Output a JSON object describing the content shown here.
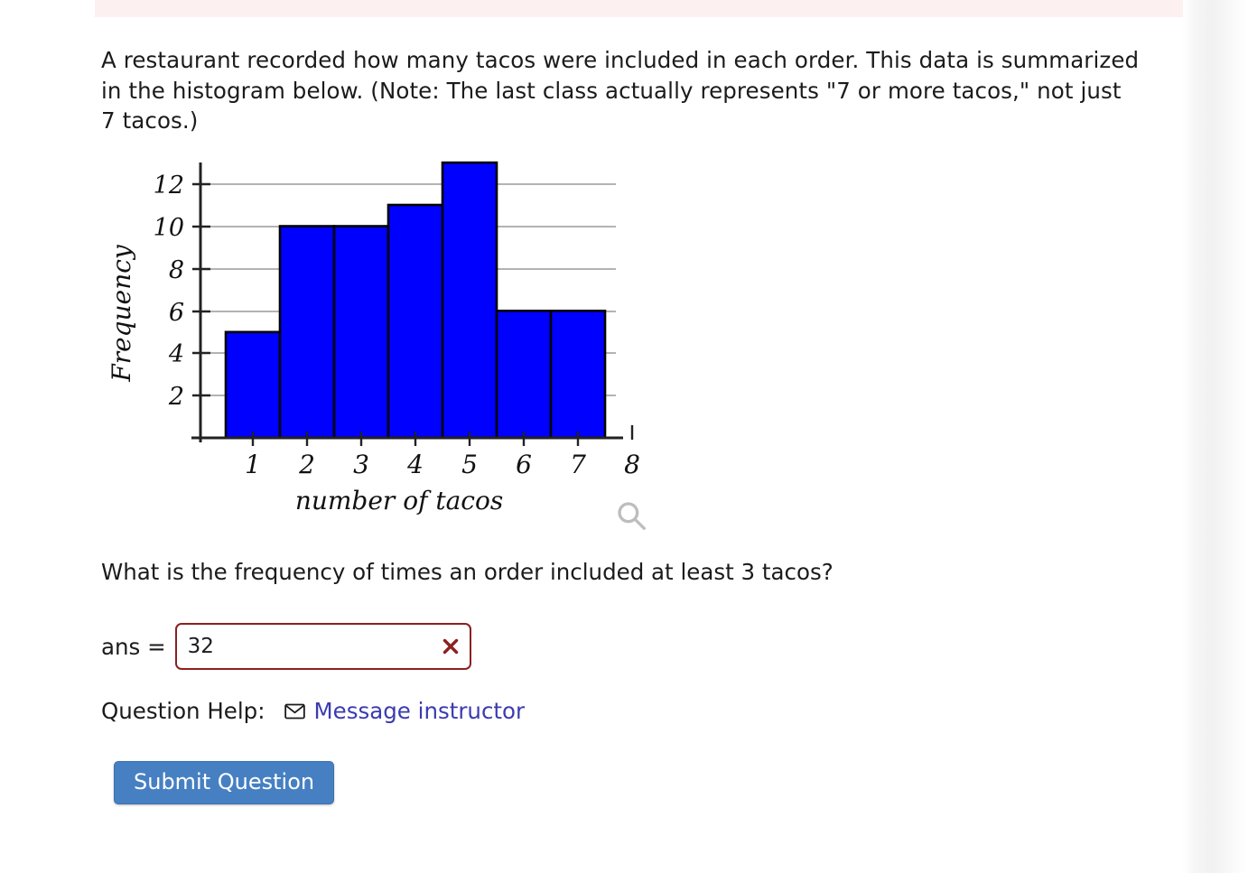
{
  "banner": {
    "color": "#fcf0f0"
  },
  "prompt": {
    "text": "A restaurant recorded how many tacos were included in each order. This data is summarized in the histogram below. (Note: The last class actually represents \"7 or more tacos,\" not just 7 tacos.)"
  },
  "subquestion": {
    "text": "What is the frequency of times an order included at least 3 tacos?"
  },
  "answer": {
    "label": "ans =",
    "value": "32",
    "placeholder": "",
    "status_icon": "x-mark-icon",
    "status_color": "#8c2020",
    "border_color": "#8c2020"
  },
  "help": {
    "label": "Question Help:",
    "icon": "envelope-icon",
    "link_label": "Message instructor",
    "link_color": "#3b3bb0"
  },
  "submit": {
    "label": "Submit Question",
    "color": "#4680c2"
  },
  "figure": {
    "zoom_icon": "magnifier-icon",
    "bar_color": "#0000ff",
    "outline_color": "#000000",
    "gridline_color": "#9a9a9a"
  },
  "chart_data": {
    "type": "bar",
    "title": "",
    "xlabel": "number of tacos",
    "ylabel": "Frequency",
    "categories": [
      "1",
      "2",
      "3",
      "4",
      "5",
      "6",
      "7"
    ],
    "values": [
      5,
      10,
      10,
      11,
      13,
      6,
      6
    ],
    "x_tick_labels": [
      "1",
      "2",
      "3",
      "4",
      "5",
      "6",
      "7",
      "8"
    ],
    "y_tick_labels": [
      "2",
      "4",
      "6",
      "8",
      "10",
      "12"
    ],
    "y_ticks": [
      2,
      4,
      6,
      8,
      10,
      12
    ],
    "xlim": [
      0,
      8.4
    ],
    "ylim": [
      0,
      14
    ],
    "grid": true,
    "legend": "none",
    "note": "Last class represents 7 or more tacos"
  }
}
